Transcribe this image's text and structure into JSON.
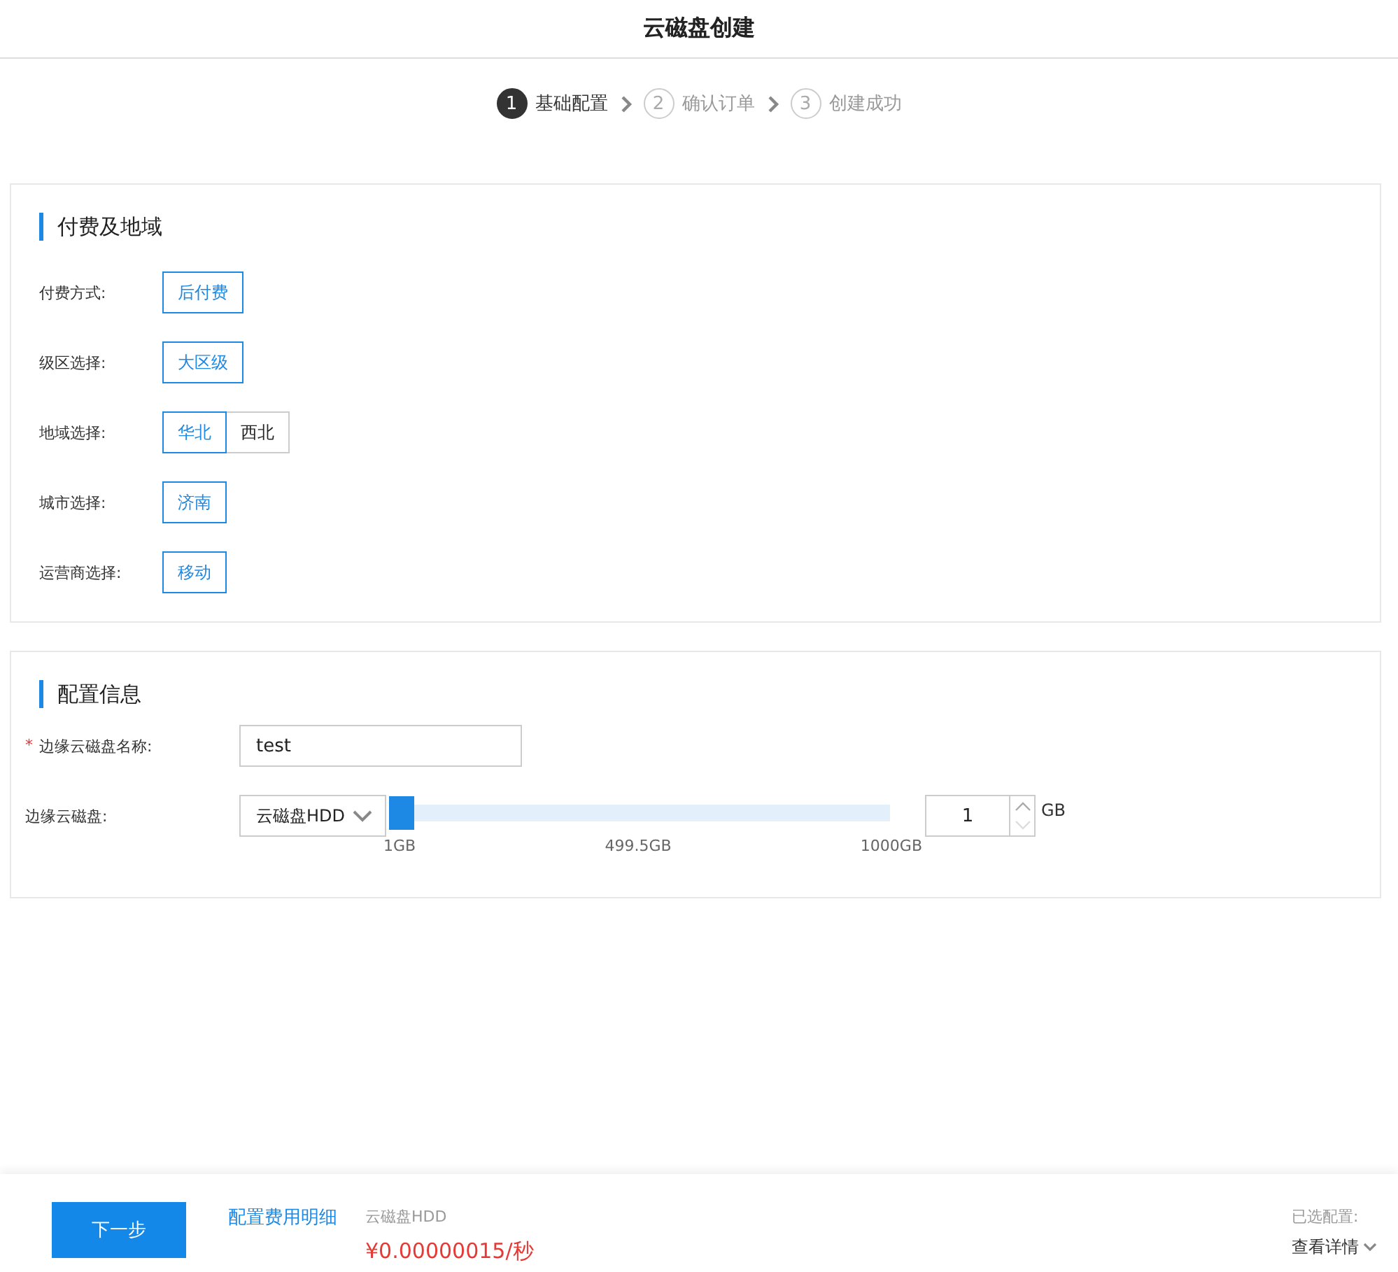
{
  "window": {
    "title": "云磁盘创建"
  },
  "steps": [
    {
      "number": "1",
      "label": "基础配置",
      "selected": true
    },
    {
      "number": "2",
      "label": "确认订单",
      "selected": false
    },
    {
      "number": "3",
      "label": "创建成功",
      "selected": false
    }
  ],
  "billing_section": {
    "title": "付费及地域",
    "rows": [
      {
        "label": "付费方式:",
        "options": [
          {
            "label": "后付费",
            "selected": true
          }
        ]
      },
      {
        "label": "级区选择:",
        "options": [
          {
            "label": "大区级",
            "selected": true
          }
        ]
      },
      {
        "label": "地域选择:",
        "options": [
          {
            "label": "华北",
            "selected": true
          },
          {
            "label": "西北",
            "selected": false
          }
        ]
      },
      {
        "label": "城市选择:",
        "options": [
          {
            "label": "济南",
            "selected": true
          }
        ]
      },
      {
        "label": "运营商选择:",
        "options": [
          {
            "label": "移动",
            "selected": true
          }
        ]
      }
    ]
  },
  "config_section": {
    "title": "配置信息",
    "name_field": {
      "label": "边缘云磁盘名称:",
      "required_mark": "*",
      "value": "test"
    },
    "disk": {
      "label": "边缘云磁盘:",
      "type_select": "云磁盘HDD",
      "slider": {
        "level": 0,
        "ticks": [
          "1GB",
          "499.5GB",
          "1000GB"
        ]
      },
      "size": "1",
      "unit": "GB"
    }
  },
  "footer": {
    "next_button": "下一步",
    "fee_link": "配置费用明细",
    "item": "云磁盘HDD",
    "price": "¥0.00000015/秒",
    "selected_label": "已选配置:",
    "details_link": "查看详情"
  }
}
